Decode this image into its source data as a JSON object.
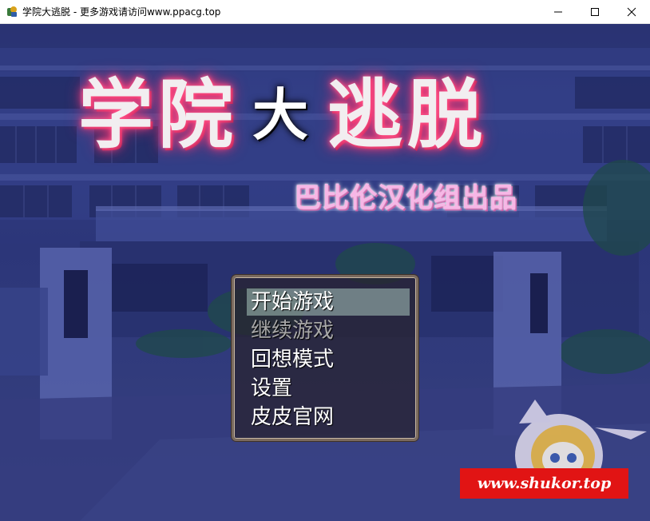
{
  "window": {
    "title": "学院大逃脱 - 更多游戏请访问www.ppacg.top",
    "icon": "game-app-icon",
    "controls": [
      "minimize-icon",
      "maximize-icon",
      "close-icon"
    ]
  },
  "logo": {
    "title_left": "学院",
    "title_mid": "大",
    "title_right": "逃脱",
    "subtitle": "巴比伦汉化组出品"
  },
  "menu": {
    "items": [
      {
        "label": "开始游戏",
        "state": "selected"
      },
      {
        "label": "继续游戏",
        "state": "disabled"
      },
      {
        "label": "回想模式",
        "state": "normal"
      },
      {
        "label": "设置",
        "state": "normal"
      },
      {
        "label": "皮皮官网",
        "state": "normal"
      }
    ]
  },
  "watermark": {
    "text": "www.shukor.top"
  },
  "colors": {
    "background": "#2f3a80",
    "logo_glow": "#ff3f7c",
    "subtitle": "#f7b6e6",
    "watermark_bg": "#e11414"
  }
}
